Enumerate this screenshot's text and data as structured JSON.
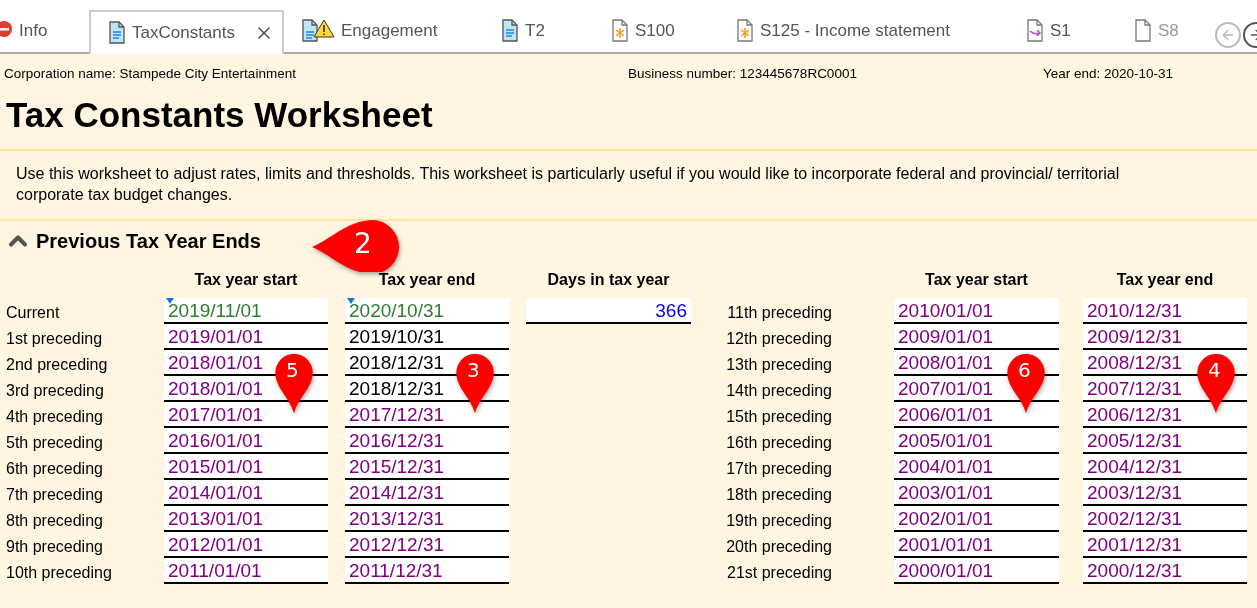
{
  "tabs": [
    {
      "label": "Info",
      "kind": "error",
      "selected": false
    },
    {
      "label": "TaxConstants",
      "kind": "worksheet",
      "selected": true
    },
    {
      "label": "Engagement",
      "kind": "warning",
      "selected": false
    },
    {
      "label": "T2",
      "kind": "worksheet",
      "selected": false
    },
    {
      "label": "S100",
      "kind": "schedule",
      "selected": false
    },
    {
      "label": "S125 - Income statement",
      "kind": "schedule",
      "selected": false
    },
    {
      "label": "S1",
      "kind": "linked",
      "selected": false
    },
    {
      "label": "S8",
      "kind": "empty",
      "selected": false
    }
  ],
  "header": {
    "corporation": "Corporation name: Stampede City Entertainment",
    "business_number": "Business number: 123445678RC0001",
    "year_end": "Year end: 2020-10-31"
  },
  "title": "Tax Constants Worksheet",
  "intro": "Use this worksheet to adjust rates, limits and thresholds. This worksheet is particularly useful if you would like to incorporate federal and provincial/ territorial corporate tax budget changes.",
  "section": {
    "title": "Previous Tax Year Ends",
    "expanded": true
  },
  "left_table": {
    "columns": [
      "Tax year start",
      "Tax year end",
      "Days in tax year"
    ],
    "rows": [
      {
        "label": "Current",
        "start": {
          "value": "2019/11/01",
          "kind": "current"
        },
        "end": {
          "value": "2020/10/31",
          "kind": "current"
        },
        "days": "366"
      },
      {
        "label": "1st preceding",
        "start": {
          "value": "2019/01/01",
          "kind": "default"
        },
        "end": {
          "value": "2019/10/31",
          "kind": "entered"
        }
      },
      {
        "label": "2nd preceding",
        "start": {
          "value": "2018/01/01",
          "kind": "default"
        },
        "end": {
          "value": "2018/12/31",
          "kind": "entered"
        }
      },
      {
        "label": "3rd preceding",
        "start": {
          "value": "2018/01/01",
          "kind": "default"
        },
        "end": {
          "value": "2018/12/31",
          "kind": "entered"
        }
      },
      {
        "label": "4th preceding",
        "start": {
          "value": "2017/01/01",
          "kind": "default"
        },
        "end": {
          "value": "2017/12/31",
          "kind": "default"
        }
      },
      {
        "label": "5th preceding",
        "start": {
          "value": "2016/01/01",
          "kind": "default"
        },
        "end": {
          "value": "2016/12/31",
          "kind": "default"
        }
      },
      {
        "label": "6th preceding",
        "start": {
          "value": "2015/01/01",
          "kind": "default"
        },
        "end": {
          "value": "2015/12/31",
          "kind": "default"
        }
      },
      {
        "label": "7th preceding",
        "start": {
          "value": "2014/01/01",
          "kind": "default"
        },
        "end": {
          "value": "2014/12/31",
          "kind": "default"
        }
      },
      {
        "label": "8th preceding",
        "start": {
          "value": "2013/01/01",
          "kind": "default"
        },
        "end": {
          "value": "2013/12/31",
          "kind": "default"
        }
      },
      {
        "label": "9th preceding",
        "start": {
          "value": "2012/01/01",
          "kind": "default"
        },
        "end": {
          "value": "2012/12/31",
          "kind": "default"
        }
      },
      {
        "label": "10th preceding",
        "start": {
          "value": "2011/01/01",
          "kind": "default"
        },
        "end": {
          "value": "2011/12/31",
          "kind": "default"
        }
      }
    ]
  },
  "right_table": {
    "columns": [
      "Tax year start",
      "Tax year end"
    ],
    "rows": [
      {
        "label": "11th preceding",
        "start": {
          "value": "2010/01/01",
          "kind": "default"
        },
        "end": {
          "value": "2010/12/31",
          "kind": "default"
        }
      },
      {
        "label": "12th preceding",
        "start": {
          "value": "2009/01/01",
          "kind": "default"
        },
        "end": {
          "value": "2009/12/31",
          "kind": "default"
        }
      },
      {
        "label": "13th preceding",
        "start": {
          "value": "2008/01/01",
          "kind": "default"
        },
        "end": {
          "value": "2008/12/31",
          "kind": "default"
        }
      },
      {
        "label": "14th preceding",
        "start": {
          "value": "2007/01/01",
          "kind": "default"
        },
        "end": {
          "value": "2007/12/31",
          "kind": "default"
        }
      },
      {
        "label": "15th preceding",
        "start": {
          "value": "2006/01/01",
          "kind": "default"
        },
        "end": {
          "value": "2006/12/31",
          "kind": "default"
        }
      },
      {
        "label": "16th preceding",
        "start": {
          "value": "2005/01/01",
          "kind": "default"
        },
        "end": {
          "value": "2005/12/31",
          "kind": "default"
        }
      },
      {
        "label": "17th preceding",
        "start": {
          "value": "2004/01/01",
          "kind": "default"
        },
        "end": {
          "value": "2004/12/31",
          "kind": "default"
        }
      },
      {
        "label": "18th preceding",
        "start": {
          "value": "2003/01/01",
          "kind": "default"
        },
        "end": {
          "value": "2003/12/31",
          "kind": "default"
        }
      },
      {
        "label": "19th preceding",
        "start": {
          "value": "2002/01/01",
          "kind": "default"
        },
        "end": {
          "value": "2002/12/31",
          "kind": "default"
        }
      },
      {
        "label": "20th preceding",
        "start": {
          "value": "2001/01/01",
          "kind": "default"
        },
        "end": {
          "value": "2001/12/31",
          "kind": "default"
        }
      },
      {
        "label": "21st preceding",
        "start": {
          "value": "2000/01/01",
          "kind": "default"
        },
        "end": {
          "value": "2000/12/31",
          "kind": "default"
        }
      }
    ]
  },
  "callouts": [
    {
      "number": "2",
      "kind": "left"
    },
    {
      "number": "5",
      "kind": "down"
    },
    {
      "number": "3",
      "kind": "down"
    },
    {
      "number": "6",
      "kind": "down"
    },
    {
      "number": "4",
      "kind": "down"
    }
  ]
}
